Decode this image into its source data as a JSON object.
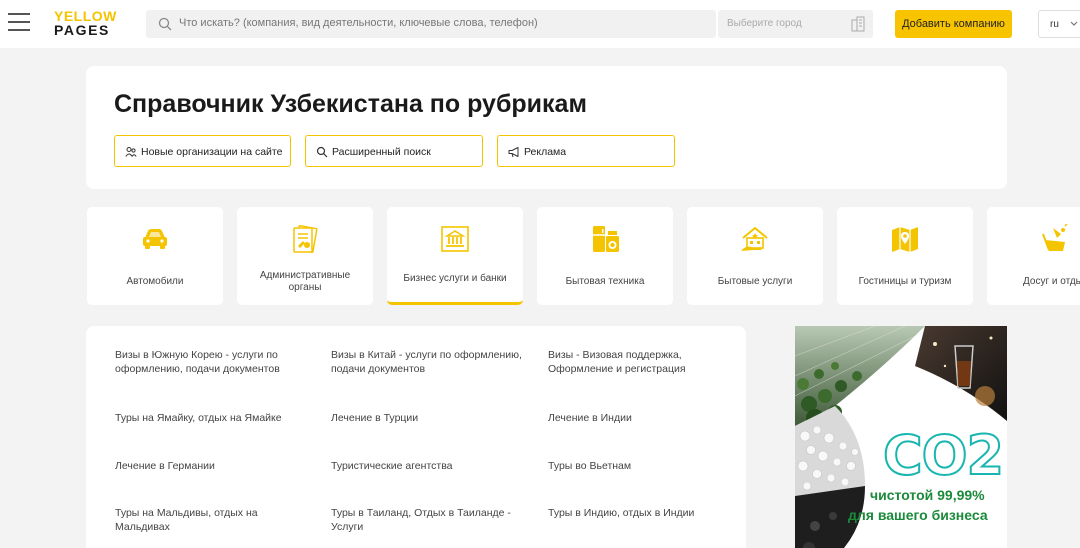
{
  "header": {
    "logo_line1": "YELLOW",
    "logo_line2": "PAGES",
    "search_placeholder": "Что искать? (компания, вид деятельности, ключевые слова, телефон)",
    "city_placeholder": "Выберите город",
    "add_company": "Добавить компанию",
    "lang": "ru"
  },
  "page": {
    "title": "Справочник Узбекистана по рубрикам",
    "chips": [
      {
        "label": "Новые организации на сайте",
        "icon": "people-icon"
      },
      {
        "label": "Расширенный поиск",
        "icon": "search-icon"
      },
      {
        "label": "Реклама",
        "icon": "megaphone-icon"
      }
    ]
  },
  "categories": [
    {
      "label": "Автомобили",
      "icon": "car-icon",
      "active": false
    },
    {
      "label": "Административные органы",
      "icon": "documents-icon",
      "active": false
    },
    {
      "label": "Бизнес услуги и банки",
      "icon": "bank-icon",
      "active": true
    },
    {
      "label": "Бытовая техника",
      "icon": "appliances-icon",
      "active": false
    },
    {
      "label": "Бытовые услуги",
      "icon": "home-services-icon",
      "active": false
    },
    {
      "label": "Гостиницы и туризм",
      "icon": "map-icon",
      "active": false
    },
    {
      "label": "Досуг и отдых",
      "icon": "leisure-icon",
      "active": false
    }
  ],
  "links": [
    [
      "Визы в Южную Корею - услуги по оформлению, подачи документов",
      "Визы в Китай - услуги по оформлению, подачи документов",
      "Визы - Визовая поддержка, Оформление и регистрация"
    ],
    [
      "Туры на Ямайку, отдых на Ямайке",
      "Лечение в Турции",
      "Лечение в Индии"
    ],
    [
      "Лечение в Германии",
      "Туристические агентства",
      "Туры во Вьетнам"
    ],
    [
      "Туры на Мальдивы, отдых на Мальдивах",
      "Туры в Таиланд, Отдых в Таиланде - Услуги",
      "Туры в Индию, отдых в Индии"
    ]
  ],
  "ad": {
    "headline": "CO2",
    "line1": "чистотой 99,99%",
    "line2": "для вашего бизнеса"
  },
  "colors": {
    "accent": "#f8c400",
    "ad_teal": "#19b5b0",
    "ad_green": "#1b8a3a"
  }
}
